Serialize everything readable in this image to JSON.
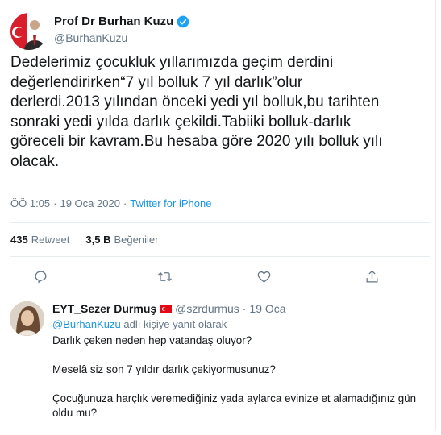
{
  "tweet": {
    "author_name": "Prof Dr Burhan Kuzu",
    "author_handle": "@BurhanKuzu",
    "text": "Dedelerimiz çocukluk yıllarımızda geçim derdini\ndeğerlendirirken“7 yıl bolluk 7 yıl darlık”olur\nderlerdi.2013 yılından önceki yedi yıl  bolluk,bu tarihten\nsonraki yedi yılda darlık çekildi.Tabiiki bolluk-darlık\ngöreceli bir kavram.Bu hesaba göre 2020 yılı bolluk yılı\nolacak.",
    "time": "ÖÖ 1:05",
    "separator": "·",
    "date": "19 Oca 2020",
    "client": "Twitter for iPhone",
    "retweet_count": "435",
    "retweet_label": "Retweet",
    "like_count": "3,5 B",
    "like_label": "Beğeniler",
    "action_icons": [
      "reply-icon",
      "retweet-icon",
      "like-icon",
      "share-icon"
    ]
  },
  "reply": {
    "name": "EYT_Sezer Durmuş",
    "flag": "turkey-flag",
    "handle": "@szrdurmus",
    "separator": "·",
    "date": "19 Oca",
    "reply_to_handle": "@BurhanKuzu",
    "reply_to_suffix": "adlı kişiye yanıt olarak",
    "lines": [
      "Darlık çeken neden hep vatandaş oluyor?",
      "Meselâ siz son 7 yıldır darlık çekiyormusunuz?",
      "Çocuğunuza harçlık veremediğiniz yada aylarca evinize et alamadığınız gün oldu mu?"
    ]
  },
  "colors": {
    "text": "#14171a",
    "muted": "#657786",
    "link": "#1b95e0",
    "divider": "#e6ecf0",
    "verified": "#1da1f2",
    "flag_red": "#e30a17"
  }
}
